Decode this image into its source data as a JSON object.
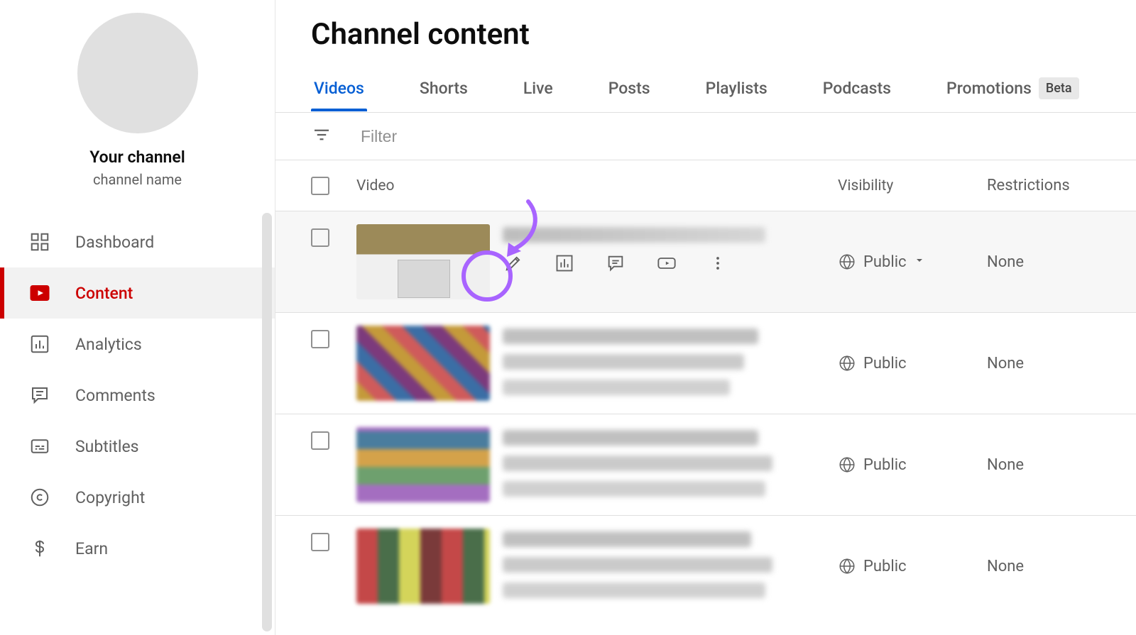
{
  "sidebar": {
    "profile_title": "Your channel",
    "profile_sub": "channel name",
    "items": [
      {
        "label": "Dashboard"
      },
      {
        "label": "Content"
      },
      {
        "label": "Analytics"
      },
      {
        "label": "Comments"
      },
      {
        "label": "Subtitles"
      },
      {
        "label": "Copyright"
      },
      {
        "label": "Earn"
      }
    ]
  },
  "page_title": "Channel content",
  "tabs": [
    {
      "label": "Videos"
    },
    {
      "label": "Shorts"
    },
    {
      "label": "Live"
    },
    {
      "label": "Posts"
    },
    {
      "label": "Playlists"
    },
    {
      "label": "Podcasts"
    },
    {
      "label": "Promotions"
    }
  ],
  "beta_badge": "Beta",
  "filter_placeholder": "Filter",
  "columns": {
    "video": "Video",
    "visibility": "Visibility",
    "restrictions": "Restrictions"
  },
  "visibility_public": "Public",
  "restrictions_none": "None",
  "rows": [
    {
      "visibility": "Public",
      "restrictions": "None",
      "hovered": true
    },
    {
      "visibility": "Public",
      "restrictions": "None",
      "hovered": false
    },
    {
      "visibility": "Public",
      "restrictions": "None",
      "hovered": false
    },
    {
      "visibility": "Public",
      "restrictions": "None",
      "hovered": false
    }
  ],
  "action_icons": [
    "edit",
    "analytics",
    "comments",
    "youtube",
    "more"
  ],
  "highlight_color": "#a864ff"
}
